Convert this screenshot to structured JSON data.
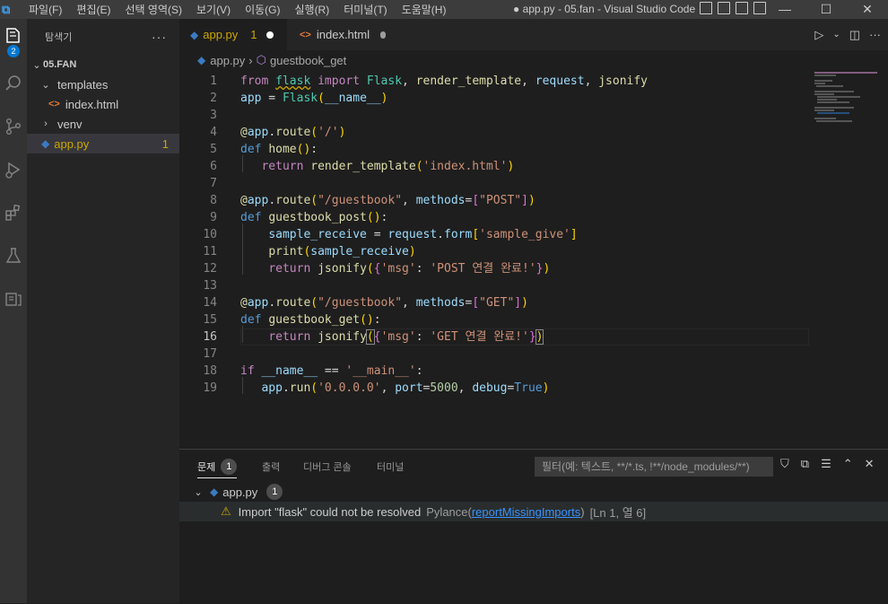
{
  "menu": [
    "파일(F)",
    "편집(E)",
    "선택 영역(S)",
    "보기(V)",
    "이동(G)",
    "실행(R)",
    "터미널(T)",
    "도움말(H)"
  ],
  "window_title": "● app.py - 05.fan - Visual Studio Code",
  "activity": {
    "explorer_badge": "2"
  },
  "sidebar": {
    "title": "탐색기",
    "more": "···",
    "root": "05.FAN",
    "items": [
      {
        "label": "templates"
      },
      {
        "label": "index.html"
      },
      {
        "label": "venv"
      },
      {
        "label": "app.py",
        "problems": "1"
      }
    ]
  },
  "tabs": [
    {
      "label": "app.py",
      "problems": "1"
    },
    {
      "label": "index.html"
    }
  ],
  "breadcrumb": {
    "file": "app.py",
    "symbol": "guestbook_get"
  },
  "editor": {
    "line_numbers": [
      "1",
      "2",
      "3",
      "4",
      "5",
      "6",
      "7",
      "8",
      "9",
      "10",
      "11",
      "12",
      "13",
      "14",
      "15",
      "16",
      "17",
      "18",
      "19"
    ],
    "current_line": "16"
  },
  "panel": {
    "tabs": [
      {
        "label": "문제",
        "badge": "1"
      },
      {
        "label": "출력"
      },
      {
        "label": "디버그 콘솔"
      },
      {
        "label": "터미널"
      }
    ],
    "filter_placeholder": "필터(예: 텍스트, **/*.ts, !**/node_modules/**)",
    "file_group": {
      "label": "app.py",
      "count": "1"
    },
    "problem": {
      "message": "Import \"flask\" could not be resolved",
      "source": "Pylance(",
      "code": "reportMissingImports",
      "source_end": ")",
      "position": "[Ln 1, 열 6]"
    }
  },
  "colors": {
    "accent": "#0078d4",
    "warning": "#cca700",
    "keyword": "#c586c0",
    "string": "#ce9178"
  }
}
